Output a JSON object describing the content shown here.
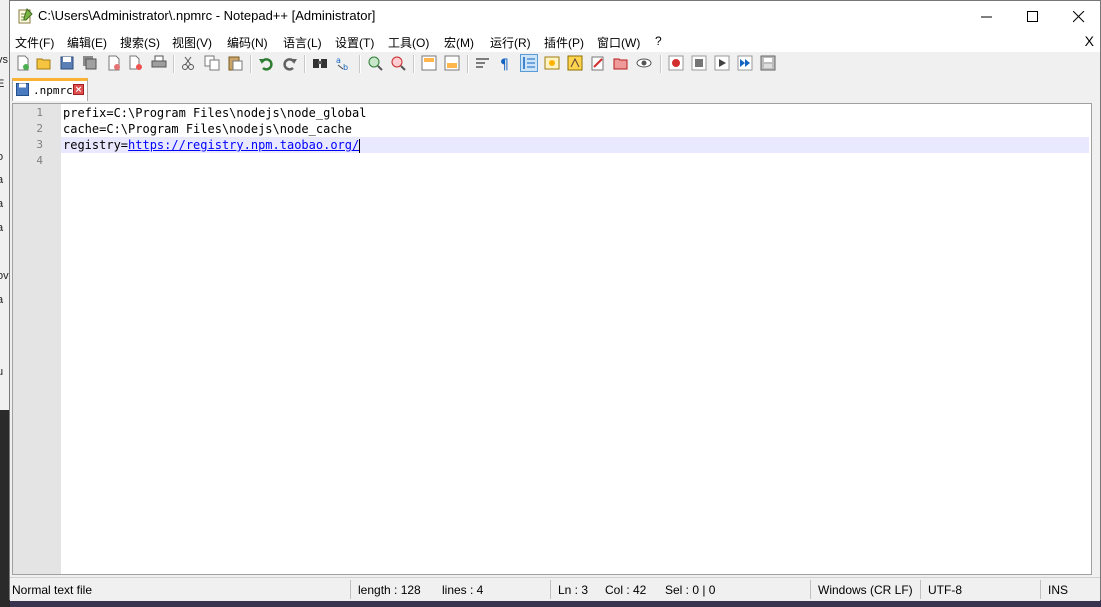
{
  "background_fragments": [
    "vs",
    "E",
    "o",
    "a",
    "a",
    "a",
    "ov",
    "a",
    "i",
    "u"
  ],
  "window": {
    "title": "C:\\Users\\Administrator\\.npmrc - Notepad++ [Administrator]",
    "controls": [
      "minimize",
      "maximize",
      "close"
    ]
  },
  "menu": {
    "items": [
      "文件(F)",
      "编辑(E)",
      "搜索(S)",
      "视图(V)",
      "编码(N)",
      "语言(L)",
      "设置(T)",
      "工具(O)",
      "宏(M)",
      "运行(R)",
      "插件(P)",
      "窗口(W)",
      "?"
    ],
    "close_label": "X"
  },
  "toolbar": {
    "icons": [
      "new-file-icon",
      "open-file-icon",
      "save-icon",
      "save-all-icon",
      "close-icon",
      "close-all-icon",
      "print-icon",
      "cut-icon",
      "copy-icon",
      "paste-icon",
      "undo-icon",
      "redo-icon",
      "find-icon",
      "replace-icon",
      "zoom-in-icon",
      "zoom-out-icon",
      "sync-vertical-icon",
      "sync-horizontal-icon",
      "word-wrap-icon",
      "show-all-chars-icon",
      "indent-guide-icon",
      "document-map-icon",
      "function-list-icon",
      "folder-as-workspace-icon",
      "monitoring-icon",
      "doc-switcher-icon",
      "record-macro-icon",
      "stop-record-icon",
      "play-macro-icon",
      "run-macro-multiple-icon",
      "save-macro-icon"
    ]
  },
  "tab": {
    "label": ".npmrc"
  },
  "editor": {
    "line_numbers": [
      "1",
      "2",
      "3",
      "4"
    ],
    "lines": [
      "prefix=C:\\Program Files\\nodejs\\node_global",
      "cache=C:\\Program Files\\nodejs\\node_cache",
      "registry=",
      ""
    ],
    "link": "https://registry.npm.taobao.org/",
    "current_line": 3
  },
  "status": {
    "file_type": "Normal text file",
    "length": "length : 128",
    "lines": "lines : 4",
    "ln": "Ln : 3",
    "col": "Col : 42",
    "sel": "Sel : 0 | 0",
    "eol": "Windows (CR LF)",
    "encoding": "UTF-8",
    "mode": "INS"
  },
  "colors": {
    "accent_tab": "#f9b233",
    "current_line_bg": "#e8e8ff",
    "link": "#0000ff",
    "gutter": "#e4e4e4"
  }
}
